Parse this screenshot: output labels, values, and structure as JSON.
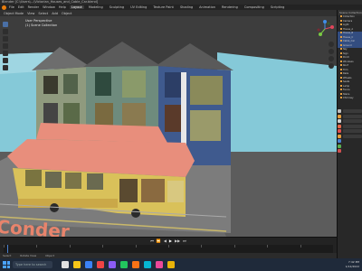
{
  "app": {
    "title": "Blender [C:\\Users\\...\\Victorian_Houses_and_Cable_Car.blend]",
    "menu": [
      "File",
      "Edit",
      "Render",
      "Window",
      "Help"
    ],
    "workspaces": [
      "Layout",
      "Modeling",
      "Sculpting",
      "UV Editing",
      "Texture Paint",
      "Shading",
      "Animation",
      "Rendering",
      "Compositing",
      "Scripting"
    ],
    "active_workspace": "Layout"
  },
  "viewport": {
    "header_items": [
      "Object Mode",
      "View",
      "Select",
      "Add",
      "Object"
    ],
    "overlay_line1": "User Perspective",
    "overlay_line2": "(1) Scene Collection",
    "sign_text": "Conder",
    "colors": {
      "sky": "#85c9d8",
      "ground": "#5c5c5c",
      "house_left": "#8f9a7e",
      "house_mid": "#6e8b7d",
      "house_right": "#3f5a8e",
      "tram_body": "#d9c15a",
      "tram_roof": "#e88e7c"
    },
    "icons": [
      "cursor-icon",
      "move-icon",
      "rotate-icon",
      "scale-icon",
      "transform-icon",
      "annotate-icon",
      "measure-icon"
    ]
  },
  "timeline": {
    "controls": [
      "⏮",
      "⏪",
      "◀",
      "▶",
      "▶▶",
      "⏭"
    ],
    "current_frame": 1
  },
  "statusbar": {
    "left": "Select",
    "middle": "Rotate View",
    "right": "Object"
  },
  "outliner": {
    "header": "Scene Collection",
    "items": [
      "Collection",
      "Camera",
      "Light",
      "House_A",
      "House_B",
      "House_C",
      "Cable_Car",
      "Ground",
      "Sky",
      "Sign",
      "Porch",
      "Windows",
      "Roof",
      "Trim",
      "Rails",
      "Wheels",
      "Seats",
      "Lamp",
      "Fence",
      "Stairs",
      "Chimney"
    ],
    "selected": [
      4,
      5,
      6,
      7
    ]
  },
  "taskbar": {
    "search_placeholder": "Type here to search",
    "time": "7:42 PM",
    "date": "1/12/2022",
    "app_colors": [
      "#e0e0e0",
      "#f5c518",
      "#3b82f6",
      "#ef4444",
      "#8b5cf6",
      "#22c55e",
      "#f97316",
      "#06b6d4",
      "#ec4899",
      "#eab308"
    ]
  }
}
